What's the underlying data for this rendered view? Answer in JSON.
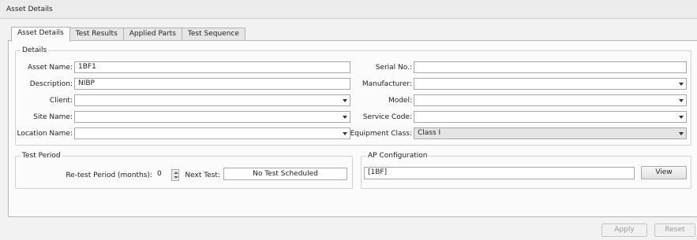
{
  "window": {
    "title": "Asset Details"
  },
  "tabs": [
    {
      "label": "Asset Details"
    },
    {
      "label": "Test Results"
    },
    {
      "label": "Applied Parts"
    },
    {
      "label": "Test Sequence"
    }
  ],
  "details": {
    "legend": "Details",
    "asset_name": {
      "label": "Asset Name:",
      "value": "1BF1"
    },
    "description": {
      "label": "Description:",
      "value": "NIBP"
    },
    "client": {
      "label": "Client:",
      "value": ""
    },
    "site_name": {
      "label": "Site Name:",
      "value": ""
    },
    "location_name": {
      "label": "Location Name:",
      "value": ""
    },
    "serial_no": {
      "label": "Serial No.:",
      "value": ""
    },
    "manufacturer": {
      "label": "Manufacturer:",
      "value": ""
    },
    "model": {
      "label": "Model:",
      "value": ""
    },
    "service_code": {
      "label": "Service Code:",
      "value": ""
    },
    "equipment_class": {
      "label": "Equipment Class:",
      "value": "Class I"
    }
  },
  "test_period": {
    "legend": "Test Period",
    "retest_label": "Re-test Period (months):",
    "retest_value": "0",
    "next_test_label": "Next Test:",
    "next_test_value": "No Test Scheduled"
  },
  "ap_config": {
    "legend": "AP Configuration",
    "value": "[1BF]",
    "view_label": "View"
  },
  "footer": {
    "apply_label": "Apply",
    "reset_label": "Reset"
  }
}
